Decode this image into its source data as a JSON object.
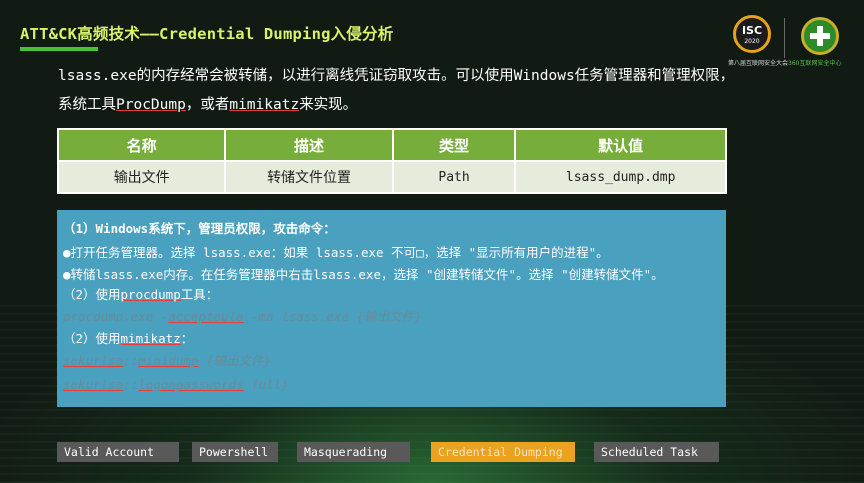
{
  "slide": {
    "title": "ATT&CK高频技术——Credential Dumping入侵分析"
  },
  "logos": {
    "isc_text": "ISC",
    "isc_year": "2020",
    "isc_caption": "第八届互联网安全大会",
    "brand_caption": "360互联网安全中心",
    "brand_color": "#2e8b2a",
    "accent_color": "#e5a21a"
  },
  "intro": {
    "part1": "lsass.exe的内存经常会被转储，以进行离线凭证窃取攻击。可以使用Windows任务管理器和管理权限，系统工具",
    "tool1": "ProcDump",
    "part2": "，或者",
    "tool2": "mimikatz",
    "part3": "来实现。"
  },
  "table": {
    "headers": [
      "名称",
      "描述",
      "类型",
      "默认值"
    ],
    "rows": [
      [
        "输出文件",
        "转储文件位置",
        "Path",
        "lsass_dump.dmp"
      ]
    ],
    "header_color": "#77ad3a",
    "cell_color": "#e6ecdc"
  },
  "panel": {
    "heading": "（1）Windows系统下，管理员权限，攻击命令：",
    "bullet1": "●打开任务管理器。选择 lsass.exe：如果 lsass.exe 不可□，选择 \"显示所有用户的进程\"。",
    "bullet2": "●转储lsass.exe内存。在任务管理器中右击lsass.exe，选择 \"创建转储文件\"。选择 \"创建转储文件\"。",
    "step2_prefix": "（2）使用",
    "step2_tool": "procdump",
    "step2_suffix": "工具：",
    "cmd1_pre": "procdump.exe -",
    "cmd1_flag": "accepteula",
    "cmd1_post": " -ma lsass.exe {输出文件}",
    "step3_prefix": "（2）使用",
    "step3_tool": "mimikatz",
    "step3_suffix": "：",
    "cmd2_a": "sekurlsa",
    "cmd2_sep": "::",
    "cmd2_b": "minidump",
    "cmd2_post": " {输出文件}",
    "cmd3_a": "sekurlsa",
    "cmd3_sep": "::",
    "cmd3_b": "logonpasswords",
    "cmd3_post": " full}",
    "background_color": "#4aa0bf"
  },
  "tabs": [
    {
      "label": "Valid Account",
      "active": false
    },
    {
      "label": "Powershell",
      "active": false
    },
    {
      "label": "Masquerading",
      "active": false
    },
    {
      "label": "Credential Dumping",
      "active": true
    },
    {
      "label": "Scheduled Task",
      "active": false
    }
  ]
}
